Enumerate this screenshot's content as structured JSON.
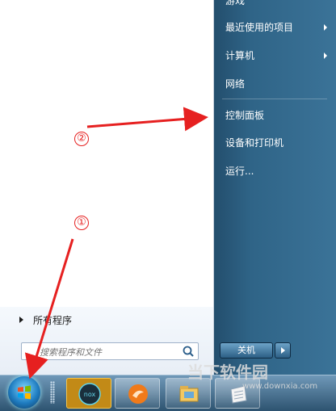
{
  "start_menu": {
    "all_programs_label": "所有程序",
    "search_placeholder": "搜索程序和文件",
    "right_items": [
      {
        "label": "游戏",
        "has_submenu": false
      },
      {
        "label": "最近使用的项目",
        "has_submenu": true
      },
      {
        "label": "计算机",
        "has_submenu": true
      },
      {
        "label": "网络",
        "has_submenu": false
      },
      {
        "label": "控制面板",
        "has_submenu": false
      },
      {
        "label": "设备和打印机",
        "has_submenu": false
      },
      {
        "label": "运行...",
        "has_submenu": false
      }
    ],
    "shutdown_label": "关机"
  },
  "taskbar": {
    "pinned_apps": [
      "nox-player-icon",
      "browser-icon",
      "file-explorer-icon",
      "notes-icon"
    ]
  },
  "annotations": {
    "marker_1": "①",
    "marker_2": "②",
    "arrow_color": "#e62020"
  },
  "watermark": {
    "text": "当下软件园",
    "url": "www.downxia.com"
  },
  "colors": {
    "right_pane": "#2f6487",
    "taskbar": "#4a7696",
    "active_task": "#c28a17"
  }
}
